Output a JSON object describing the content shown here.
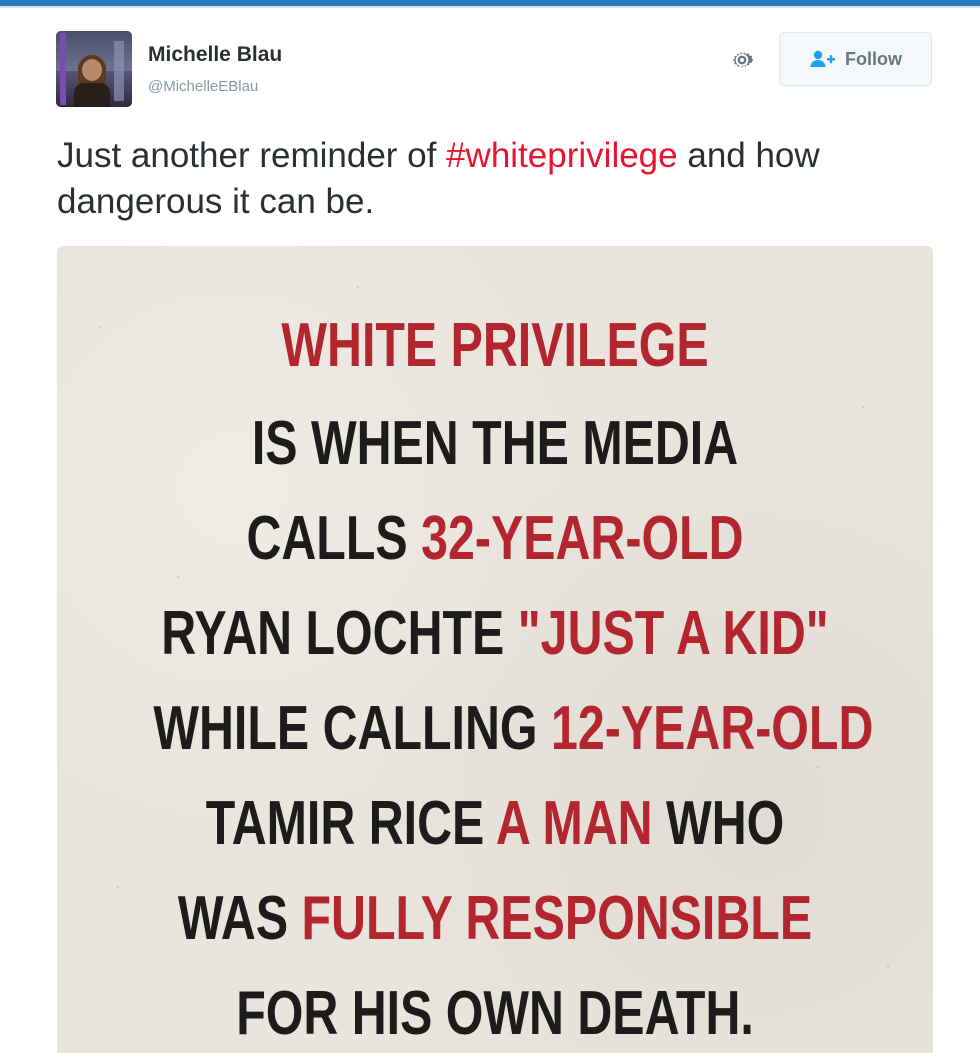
{
  "tweet": {
    "display_name": "Michelle Blau",
    "handle": "@MichelleEBlau",
    "follow_label": "Follow",
    "text_before": "Just another reminder of ",
    "hashtag": "#whiteprivilege",
    "text_after": " and how dangerous it can be."
  },
  "icons": {
    "gear": "gear-icon",
    "follow": "add-user-icon"
  },
  "colors": {
    "top_bar": "#2b7bb9",
    "hashtag": "#e8142f",
    "poster_red": "#b3262e",
    "poster_dark": "#1c1c1c",
    "poster_bg": "#e9e4dc"
  },
  "image": {
    "line1": [
      "WHITE PRIVILEGE"
    ],
    "line2": [
      "IS WHEN THE MEDIA"
    ],
    "line3a": "CALLS ",
    "line3b": "32-YEAR-OLD",
    "line4a": "RYAN LOCHTE ",
    "line4b": "\"JUST A KID\"",
    "line5a": "WHILE CALLING ",
    "line5b": "12-YEAR-OLD",
    "line6a": "TAMIR RICE ",
    "line6b": "A MAN",
    "line6c": " WHO",
    "line7a": "WAS ",
    "line7b": "FULLY RESPONSIBLE",
    "line8": "FOR HIS OWN DEATH."
  }
}
